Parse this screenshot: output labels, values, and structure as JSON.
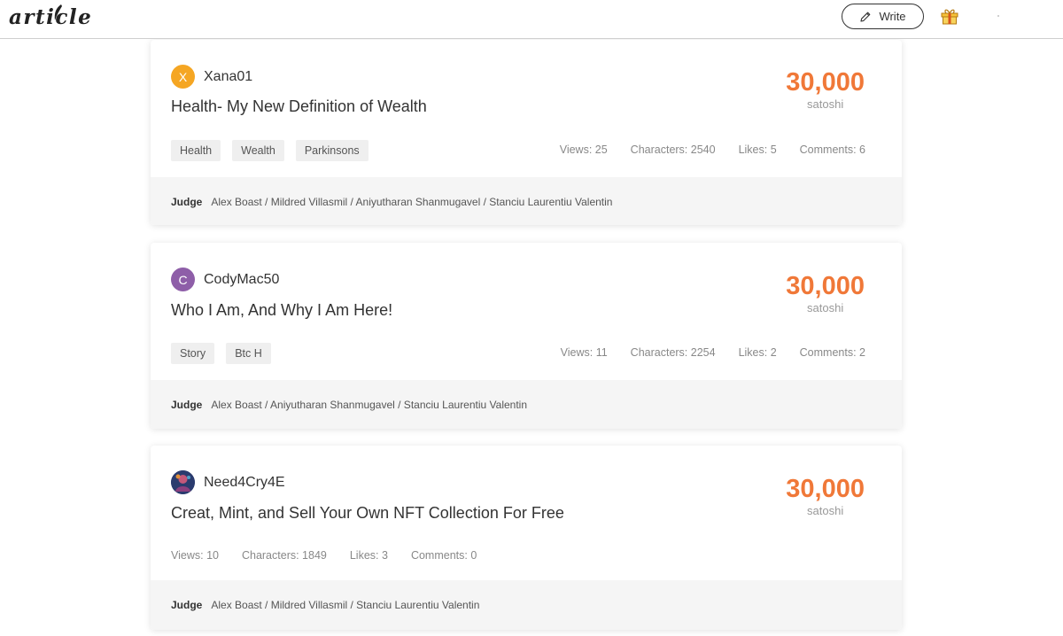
{
  "header": {
    "logo_text": "article",
    "write_label": "Write",
    "icons": {
      "write": "pencil-icon",
      "gift": "gift-icon"
    }
  },
  "colors": {
    "accent": "#f07838",
    "avatar_orange": "#f5a623",
    "avatar_purple": "#8e5ea8"
  },
  "articles": [
    {
      "author": "Xana01",
      "avatar_letter": "X",
      "title": "Health- My New Definition of Wealth",
      "amount": "30,000",
      "unit": "satoshi",
      "tags": [
        "Health",
        "Wealth",
        "Parkinsons"
      ],
      "stats": {
        "views": "Views: 25",
        "characters": "Characters: 2540",
        "likes": "Likes: 5",
        "comments": "Comments: 6"
      },
      "judge_label": "Judge",
      "judges": "Alex Boast / Mildred Villasmil / Aniyutharan Shanmugavel / Stanciu Laurentiu Valentin"
    },
    {
      "author": "CodyMac50",
      "avatar_letter": "C",
      "title": "Who I Am, And Why I Am Here!",
      "amount": "30,000",
      "unit": "satoshi",
      "tags": [
        "Story",
        "Btc H"
      ],
      "stats": {
        "views": "Views: 11",
        "characters": "Characters: 2254",
        "likes": "Likes: 2",
        "comments": "Comments: 2"
      },
      "judge_label": "Judge",
      "judges": "Alex Boast / Aniyutharan Shanmugavel / Stanciu Laurentiu Valentin"
    },
    {
      "author": "Need4Cry4E",
      "avatar_letter": "",
      "title": "Creat, Mint, and Sell Your Own NFT Collection For Free",
      "amount": "30,000",
      "unit": "satoshi",
      "tags": [],
      "stats": {
        "views": "Views: 10",
        "characters": "Characters: 1849",
        "likes": "Likes: 3",
        "comments": "Comments: 0"
      },
      "judge_label": "Judge",
      "judges": "Alex Boast / Mildred Villasmil / Stanciu Laurentiu Valentin"
    }
  ]
}
